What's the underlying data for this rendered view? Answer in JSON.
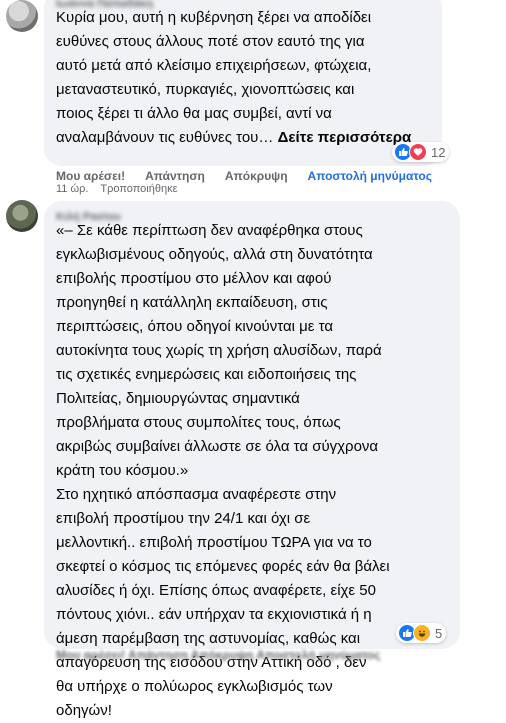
{
  "comment1": {
    "author": "Ιωάννα Παπαδάκη",
    "text": "Κυρία μου, αυτή η κυβέρνηση ξέρει να αποδίδει\nευθύνες στους άλλους ποτέ στον εαυτό της για\nαυτό μετά από κλείσιμο επιχειρήσεων, φτώχεια,\nμεταναστευτικό, πυρκαγιές, χιονοπτώσεις και\nποιος ξέρει τι άλλο θα μας συμβεί, αντί να\nαναλαμβάνουν τις ευθύνες του…",
    "see_more": "Δείτε περισσότερα",
    "reaction_count": "12",
    "actions": {
      "like": "Μου αρέσει!",
      "reply": "Απάντηση",
      "hide": "Απόκρυψη",
      "send_message": "Αποστολή μηνύματος"
    },
    "time": "11 ώρ.",
    "edited": "Τροποποιήθηκε"
  },
  "comment2": {
    "author": "Κιλή Ρασίου",
    "text": "«– Σε κάθε περίπτωση δεν αναφέρθηκα στους\nεγκλωβισμένους οδηγούς, αλλά στη δυνατότητα\nεπιβολής προστίμου στο μέλλον και αφού\nπροηγηθεί η κατάλληλη εκπαίδευση, στις\nπεριπτώσεις, όπου οδηγοί κινούνται με τα\nαυτοκίνητα τους χωρίς τη χρήση αλυσίδων, παρά\nτις σχετικές ενημερώσεις και ειδοποιήσεις της\nΠολιτείας, δημιουργώντας σημαντικά\nπροβλήματα στους συμπολίτες τους, όπως\nακριβώς συμβαίνει άλλωστε σε όλα τα σύγχρονα\nκράτη του κόσμου.»\nΣτο ηχητικό απόσπασμα αναφέρεστε στην\nεπιβολή προστίμου την 24/1 και όχι σε\nμελλοντική.. επιβολή προστίμου ΤΩΡΑ για να το\nσκεφτεί ο κόσμος τις επόμενες φορές εάν θα βάλει\nαλυσίδες ή όχι. Επίσης όπως αναφέρετε, είχε 50\nπόντους χιόνι.. εάν υπήρχαν τα εκχιονιστικά ή η\nάμεση παρέμβαση της αστυνομίας, καθώς και\nαπαγόρευση της εισόδου στην Αττική οδό , δεν\nθα υπήρχε ο πολύωρος εγκλωβισμός των\nοδηγών!",
    "reaction_count": "5",
    "bottom_actions": "Μου αρέσει!   Απάντηση   Απόκρυψη   Αποστολή μηνύματος"
  },
  "icons": {
    "like": "thumbs-up-icon",
    "love": "heart-icon",
    "haha": "laughing-face-icon"
  },
  "colors": {
    "bubble": "#f0f2f5",
    "like": "#1877f2",
    "love": "#f33e58",
    "haha": "#f7b125",
    "link": "#216fdb"
  }
}
